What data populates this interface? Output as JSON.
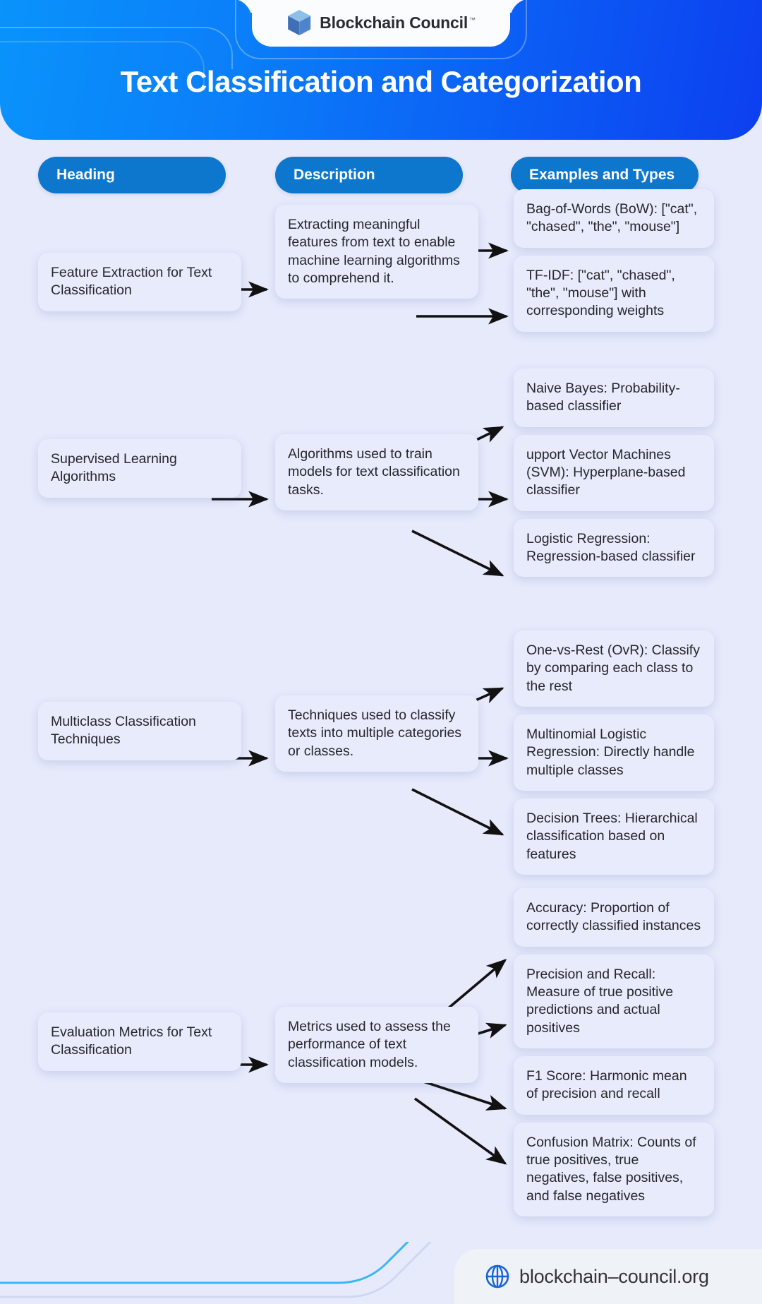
{
  "brand": {
    "logo_text": "Blockchain Council",
    "logo_tm": "™",
    "logo_icon": "cube-icon"
  },
  "header": {
    "title": "Text Classification and Categorization",
    "gradient_start": "#0a93fb",
    "gradient_end": "#0d3ff0"
  },
  "columns": {
    "heading": "Heading",
    "description": "Description",
    "examples": "Examples and Types",
    "pill_color": "#0d76cd"
  },
  "rows": [
    {
      "heading": "Feature Extraction for Text Classification",
      "description": "Extracting meaningful features from text to enable machine learning algorithms to comprehend it.",
      "examples": [
        "Bag-of-Words (BoW): [\"cat\", \"chased\", \"the\", \"mouse\"]",
        "TF-IDF: [\"cat\", \"chased\", \"the\", \"mouse\"] with corresponding weights"
      ]
    },
    {
      "heading": "Supervised Learning Algorithms",
      "description": "Algorithms used to train models for text classification tasks.",
      "examples": [
        "Naive Bayes: Probability-based classifier",
        "upport Vector Machines (SVM): Hyperplane-based classifier",
        "Logistic Regression: Regression-based classifier"
      ]
    },
    {
      "heading": "Multiclass Classification Techniques",
      "description": "Techniques used to classify texts into multiple categories or classes.",
      "examples": [
        "One-vs-Rest (OvR): Classify by comparing each class to the rest",
        "Multinomial Logistic Regression: Directly handle multiple classes",
        "Decision Trees: Hierarchical classification based on features"
      ]
    },
    {
      "heading": "Evaluation Metrics for Text Classification",
      "description": "Metrics used to assess the performance of text classification models.",
      "examples": [
        "Accuracy: Proportion of correctly classified instances",
        "Precision and Recall: Measure of true positive predictions and actual positives",
        "F1 Score: Harmonic mean of precision and recall",
        "Confusion Matrix: Counts of true positives, true negatives, false positives, and false negatives"
      ]
    }
  ],
  "footer": {
    "url": "blockchain–council.org",
    "icon": "globe-icon",
    "icon_color": "#1565d8"
  },
  "theme": {
    "page_background": "#e7eafb",
    "card_background": "#e8ebfc",
    "text_color": "#25272b"
  }
}
